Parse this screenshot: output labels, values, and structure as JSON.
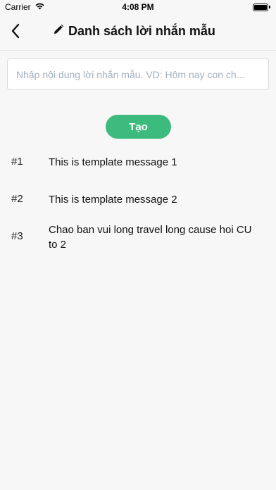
{
  "status_bar": {
    "carrier": "Carrier",
    "time": "4:08 PM",
    "icons": [
      "wifi-icon",
      "battery-icon"
    ]
  },
  "header": {
    "back_icon": "chevron-left-icon",
    "title_icon": "pencil-icon",
    "title": "Danh sách lời nhắn mẫu"
  },
  "input": {
    "value": "",
    "placeholder": "Nhập nội dung lời nhắn mẫu. VD: Hôm nay con ch..."
  },
  "create_button": {
    "label": "Tạo",
    "color": "#3dba7e"
  },
  "templates": [
    {
      "number": "#1",
      "text": "This is template message 1"
    },
    {
      "number": "#2",
      "text": "This is template message 2"
    },
    {
      "number": "#3",
      "text": "Chao ban vui long travel long cause hoi CU to 2"
    }
  ]
}
